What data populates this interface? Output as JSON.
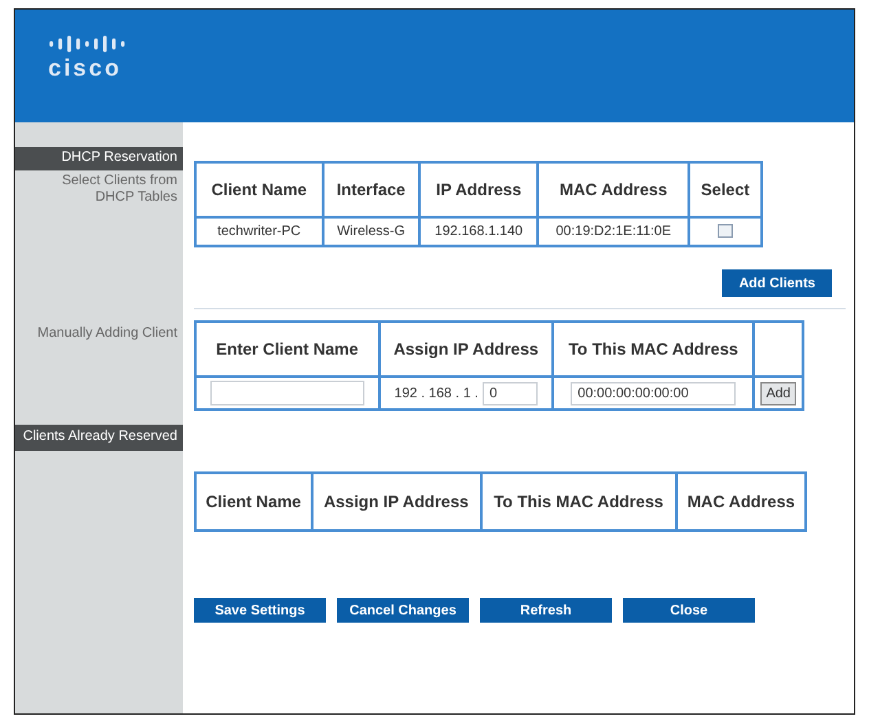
{
  "logo": {
    "text": "cisco"
  },
  "dhcp_reservation": {
    "heading": "DHCP Reservation",
    "caption": "Select Clients from DHCP Tables",
    "columns": [
      "Client Name",
      "Interface",
      "IP Address",
      "MAC Address",
      "Select"
    ],
    "rows": [
      {
        "client_name": "techwriter-PC",
        "interface": "Wireless-G",
        "ip_address": "192.168.1.140",
        "mac_address": "00:19:D2:1E:11:0E",
        "checked": false
      }
    ],
    "add_button": "Add Clients"
  },
  "manual_add": {
    "caption": "Manually Adding Client",
    "columns": [
      "Enter Client Name",
      "Assign IP Address",
      "To This MAC Address"
    ],
    "ip_prefix": "192 . 168 . 1 .",
    "ip_last": "0",
    "mac": "00:00:00:00:00:00",
    "add_button": "Add"
  },
  "reserved": {
    "heading": "Clients Already Reserved",
    "columns": [
      "Client Name",
      "Assign IP Address",
      "To This MAC Address",
      "MAC Address"
    ]
  },
  "buttons": [
    "Save Settings",
    "Cancel Changes",
    "Refresh",
    "Close"
  ]
}
